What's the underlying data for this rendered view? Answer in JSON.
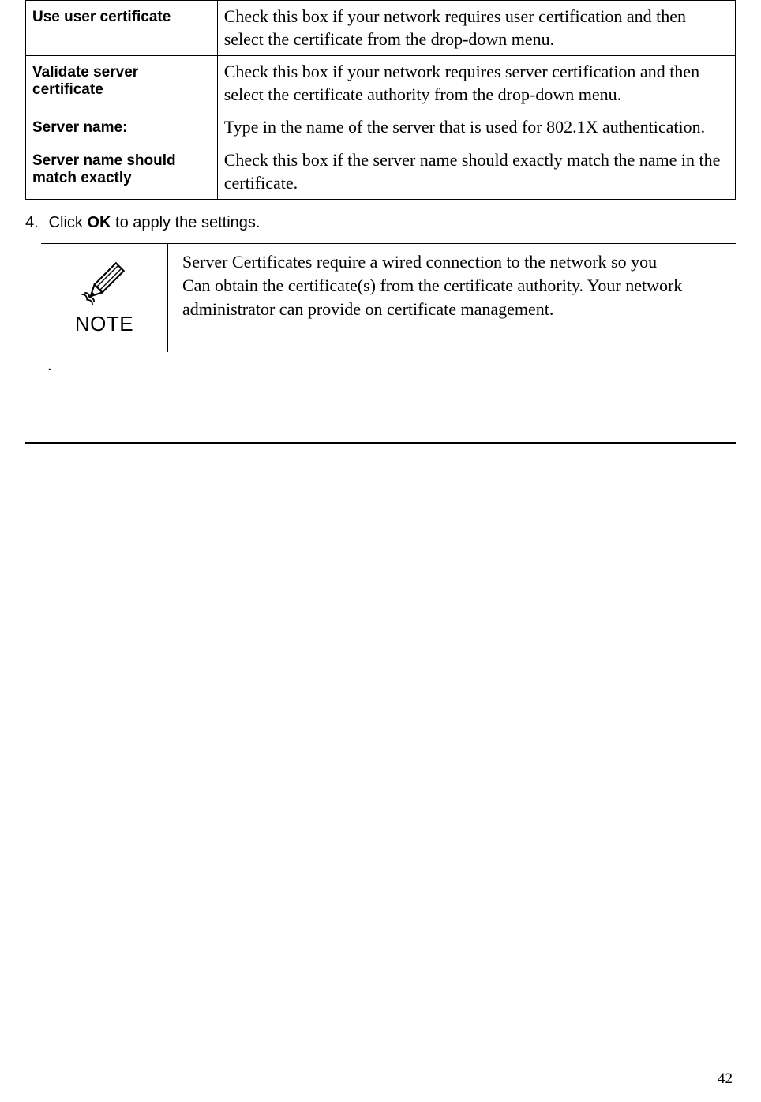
{
  "table": {
    "rows": [
      {
        "label": "Use user certificate",
        "desc": "Check this box if your network requires user certification and then select the certificate from the drop-down menu."
      },
      {
        "label": "Validate server certificate",
        "desc": "Check this box if your network requires server certification and then select the certificate authority from the drop-down menu."
      },
      {
        "label": "Server name:",
        "desc": "Type in the name of the server that is used for 802.1X authentication."
      },
      {
        "label": "Server name should match exactly",
        "desc": "Check this box if the server name should exactly match the name in the certificate."
      }
    ]
  },
  "instruction": {
    "number": "4.",
    "prefix": "Click ",
    "bold": "OK",
    "suffix": " to apply the settings."
  },
  "note": {
    "label": "NOTE",
    "line1": "Server Certificates require a wired connection to the network so you",
    "line2": "Can obtain the certificate(s) from the certificate authority. Your network administrator can provide on certificate management."
  },
  "dot": ".",
  "page_number": "42"
}
